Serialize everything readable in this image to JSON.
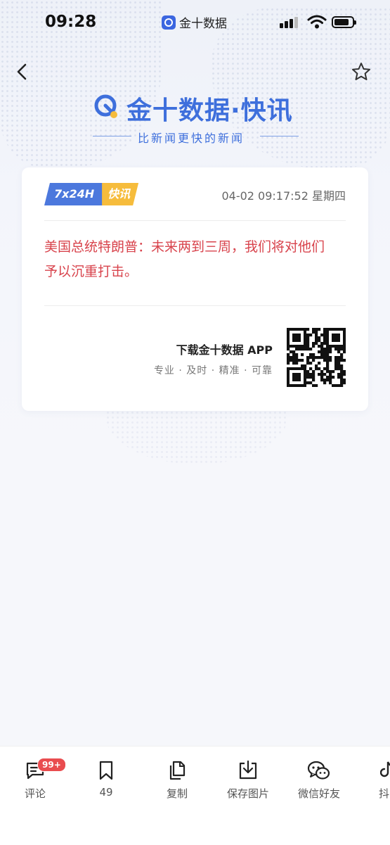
{
  "status_bar": {
    "time": "09:28",
    "app_name": "金十数据"
  },
  "brand": {
    "title": "金十数据·快讯",
    "subtitle": "比新闻更快的新闻",
    "color": "#3e6fdc"
  },
  "card": {
    "tag_primary": "7x24H",
    "tag_secondary": "快讯",
    "timestamp": "04-02 09:17:52 星期四",
    "news": "美国总统特朗普：未来两到三周，我们将对他们予以沉重打击。",
    "news_color": "#d8434c",
    "promo_title": "下载金十数据 APP",
    "promo_sub": "专业 · 及时 · 精准 · 可靠",
    "qr_icon": "qr-code-icon"
  },
  "toolbar": {
    "comment_label": "评论",
    "comment_badge": "99+",
    "bookmark_label": "49",
    "copy_label": "复制",
    "save_label": "保存图片",
    "wechat_label": "微信好友",
    "douyin_label": "抖"
  }
}
